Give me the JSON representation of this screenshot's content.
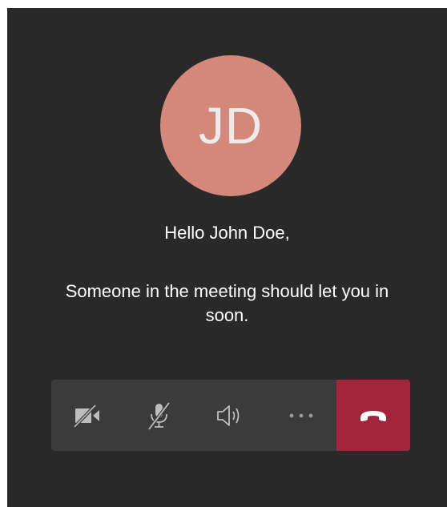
{
  "caller": {
    "initials": "JD"
  },
  "greeting": "Hello John Doe,",
  "message": "Someone in the meeting should let you in soon.",
  "toolbar": {
    "buttons": [
      {
        "icon": "camera-off-icon"
      },
      {
        "icon": "microphone-off-icon"
      },
      {
        "icon": "speaker-icon"
      },
      {
        "icon": "more-options-icon"
      },
      {
        "icon": "hang-up-icon"
      }
    ]
  },
  "colors": {
    "background": "#292929",
    "avatar": "#d4887a",
    "toolbar": "#3b3b3b",
    "hangup": "#a4253b"
  }
}
